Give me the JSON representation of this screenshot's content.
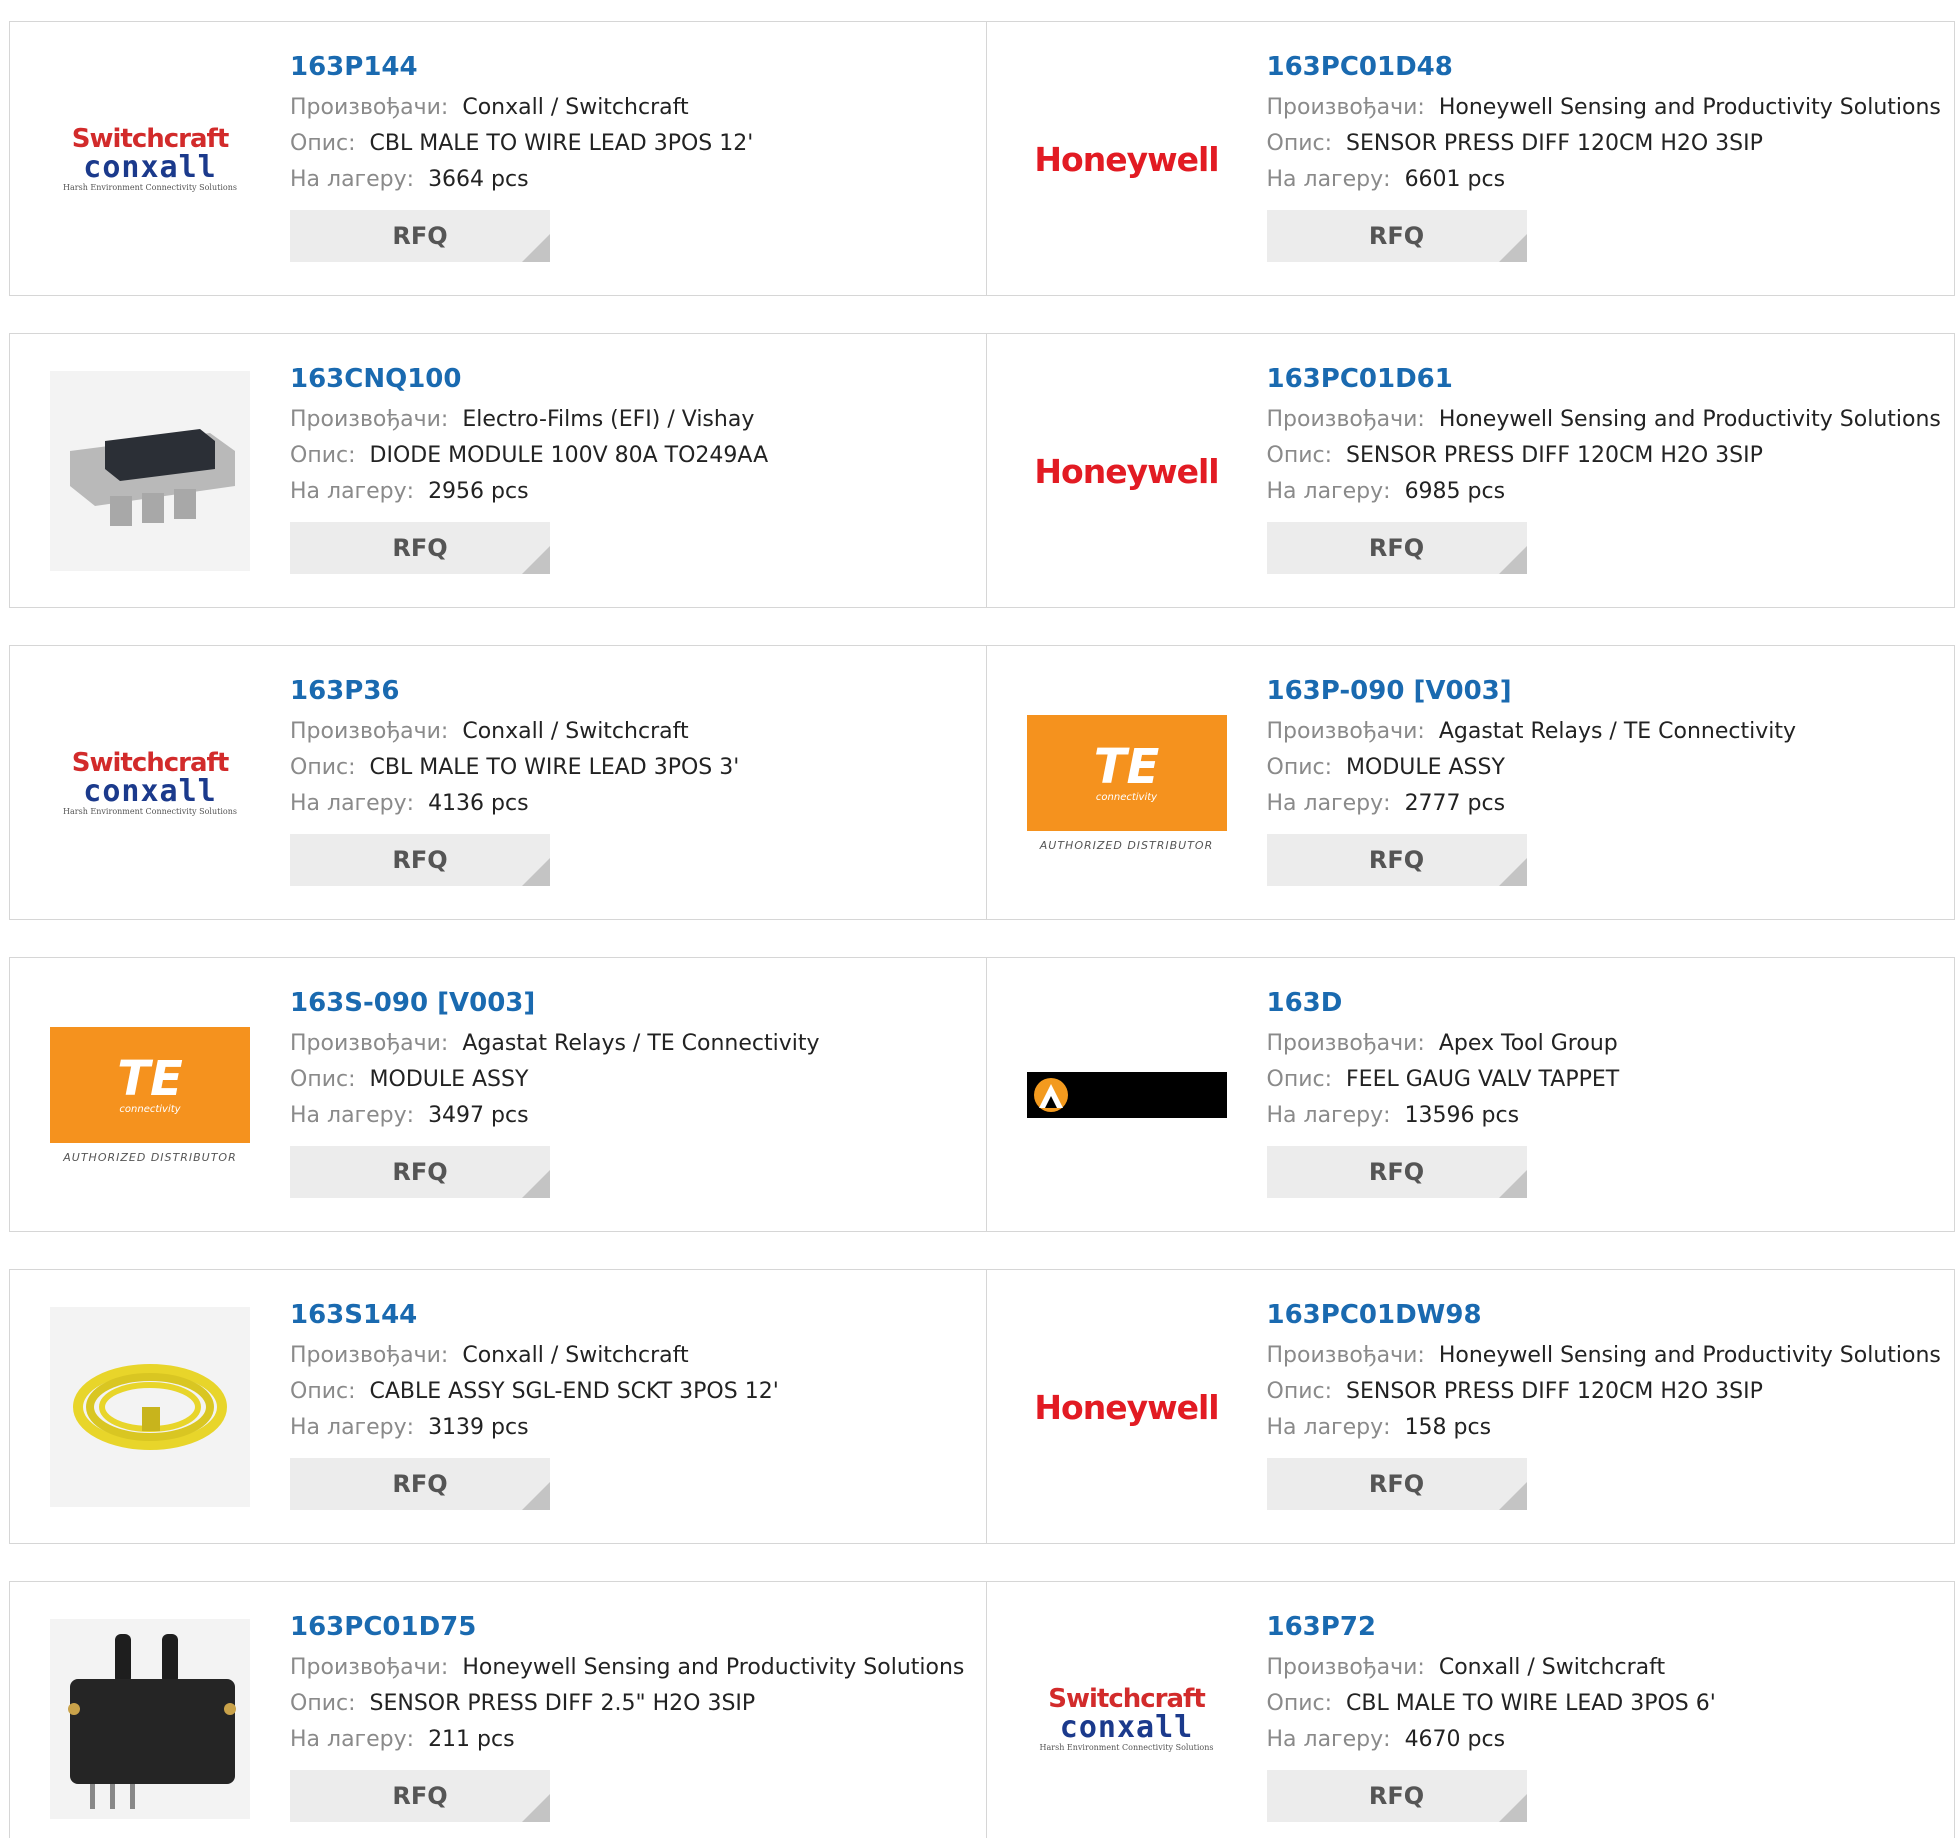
{
  "labels": {
    "manufacturer": "Произвођачи:",
    "description": "Опис:",
    "stock": "На лагеру:",
    "rfq": "RFQ"
  },
  "logo_text": {
    "switchcraft": "Switchcraft",
    "conxall": "conxall",
    "conxall_tagline": "Harsh Environment Connectivity Solutions",
    "honeywell": "Honeywell",
    "te": "TE",
    "te_sub": "connectivity",
    "te_auth": "AUTHORIZED DISTRIBUTOR"
  },
  "products": [
    {
      "part": "163P144",
      "manufacturer": "Conxall / Switchcraft",
      "description": "CBL MALE TO WIRE LEAD 3POS 12'",
      "stock": "3664 pcs",
      "logo": "switchcraft-conxall-logo"
    },
    {
      "part": "163PC01D48",
      "manufacturer": "Honeywell Sensing and Productivity Solutions",
      "description": "SENSOR PRESS DIFF 120CM H2O 3SIP",
      "stock": "6601 pcs",
      "logo": "honeywell-logo"
    },
    {
      "part": "163CNQ100",
      "manufacturer": "Electro-Films (EFI) / Vishay",
      "description": "DIODE MODULE 100V 80A TO249AA",
      "stock": "2956 pcs",
      "logo": "diode-module-photo"
    },
    {
      "part": "163PC01D61",
      "manufacturer": "Honeywell Sensing and Productivity Solutions",
      "description": "SENSOR PRESS DIFF 120CM H2O 3SIP",
      "stock": "6985 pcs",
      "logo": "honeywell-logo"
    },
    {
      "part": "163P36",
      "manufacturer": "Conxall / Switchcraft",
      "description": "CBL MALE TO WIRE LEAD 3POS 3'",
      "stock": "4136 pcs",
      "logo": "switchcraft-conxall-logo"
    },
    {
      "part": "163P-090 [V003]",
      "manufacturer": "Agastat Relays / TE Connectivity",
      "description": "MODULE ASSY",
      "stock": "2777 pcs",
      "logo": "te-connectivity-logo"
    },
    {
      "part": "163S-090 [V003]",
      "manufacturer": "Agastat Relays / TE Connectivity",
      "description": "MODULE ASSY",
      "stock": "3497 pcs",
      "logo": "te-connectivity-logo"
    },
    {
      "part": "163D",
      "manufacturer": "Apex Tool Group",
      "description": "FEEL GAUG VALV TAPPET",
      "stock": "13596 pcs",
      "logo": "apex-tool-group-logo"
    },
    {
      "part": "163S144",
      "manufacturer": "Conxall / Switchcraft",
      "description": "CABLE ASSY SGL-END SCKT 3POS 12'",
      "stock": "3139 pcs",
      "logo": "yellow-cable-photo"
    },
    {
      "part": "163PC01DW98",
      "manufacturer": "Honeywell Sensing and Productivity Solutions",
      "description": "SENSOR PRESS DIFF 120CM H2O 3SIP",
      "stock": "158 pcs",
      "logo": "honeywell-logo"
    },
    {
      "part": "163PC01D75",
      "manufacturer": "Honeywell Sensing and Productivity Solutions",
      "description": "SENSOR PRESS DIFF 2.5\" H2O 3SIP",
      "stock": "211 pcs",
      "logo": "pressure-sensor-photo"
    },
    {
      "part": "163P72",
      "manufacturer": "Conxall / Switchcraft",
      "description": "CBL MALE TO WIRE LEAD 3POS 6'",
      "stock": "4670 pcs",
      "logo": "switchcraft-conxall-logo"
    }
  ]
}
